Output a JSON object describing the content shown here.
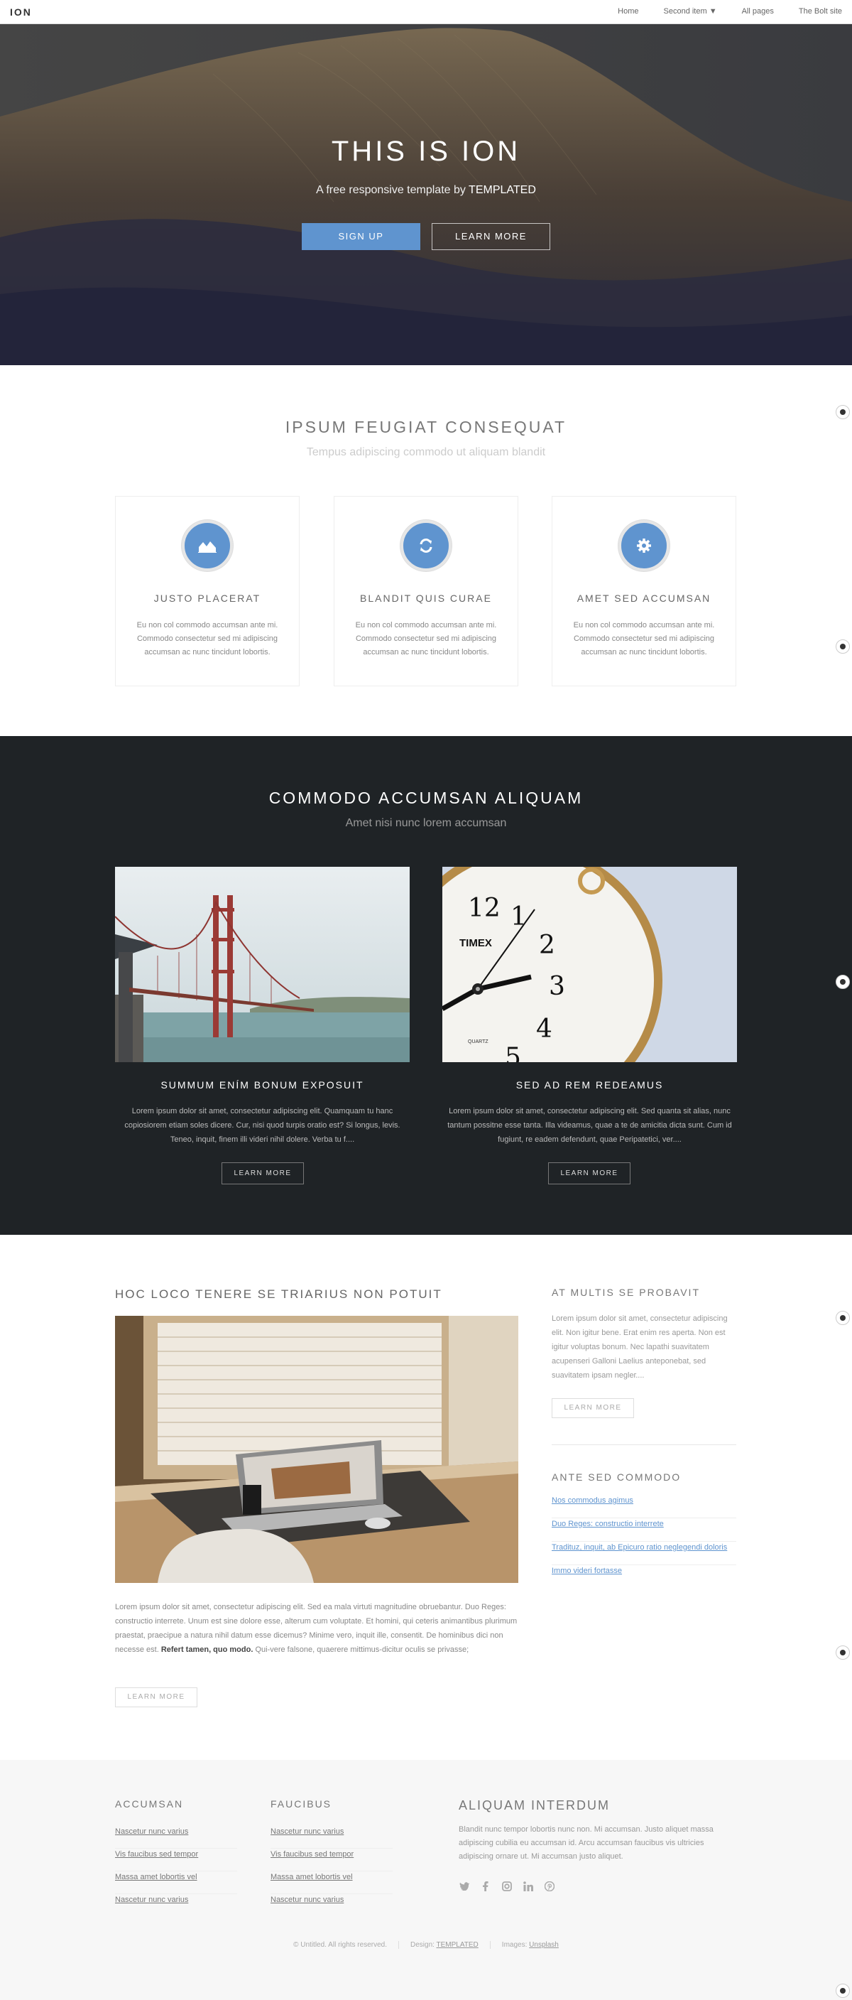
{
  "header": {
    "logo": "ION",
    "nav": [
      {
        "label": "Home"
      },
      {
        "label": "Second item ▼"
      },
      {
        "label": "All pages"
      },
      {
        "label": "The Bolt site"
      }
    ]
  },
  "hero": {
    "title": "THIS IS ION",
    "subtitle_prefix": "A free responsive template by ",
    "subtitle_brand": "TEMPLATED",
    "primary_button": "SIGN UP",
    "secondary_button": "LEARN MORE"
  },
  "features": {
    "title": "IPSUM FEUGIAT CONSEQUAT",
    "subtitle": "Tempus adipiscing commodo ut aliquam blandit",
    "items": [
      {
        "icon": "area-chart-icon",
        "title": "JUSTO PLACERAT",
        "text": "Eu non col commodo accumsan ante mi. Commodo consectetur sed mi adipiscing accumsan ac nunc tincidunt lobortis."
      },
      {
        "icon": "refresh-icon",
        "title": "BLANDIT QUIS CURAE",
        "text": "Eu non col commodo accumsan ante mi. Commodo consectetur sed mi adipiscing accumsan ac nunc tincidunt lobortis."
      },
      {
        "icon": "gear-icon",
        "title": "AMET SED ACCUMSAN",
        "text": "Eu non col commodo accumsan ante mi. Commodo consectetur sed mi adipiscing accumsan ac nunc tincidunt lobortis."
      }
    ]
  },
  "dark": {
    "title": "COMMODO ACCUMSAN ALIQUAM",
    "subtitle": "Amet nisi nunc lorem accumsan",
    "posts": [
      {
        "title": "SUMMUM ENÍM BONUM EXPOSUIT",
        "text": "Lorem ipsum dolor sit amet, consectetur adipiscing elit. Quamquam tu hanc copiosiorem etiam soles dicere. Cur, nisi quod turpis oratio est? Si longus, levis. Teneo, inquit, finem illi videri nihil dolere. Verba tu f....",
        "button": "LEARN MORE"
      },
      {
        "title": "SED AD REM REDEAMUS",
        "text": "Lorem ipsum dolor sit amet, consectetur adipiscing elit. Sed quanta sit alias, nunc tantum possitne esse tanta. Illa videamus, quae a te de amicitia dicta sunt. Cum id fugiunt, re eadem defendunt, quae Peripatetici, ver....",
        "button": "LEARN MORE"
      }
    ],
    "clock_brand": "TIMEX",
    "clock_sub": "QUARTZ"
  },
  "main": {
    "title": "HOC LOCO TENERE SE TRIARIUS NON POTUIT",
    "text_before_bold": "Lorem ipsum dolor sit amet, consectetur adipiscing elit. Sed ea mala virtuti magnitudine obruebantur. Duo Reges: constructio interrete. Unum est sine dolore esse, alterum cum voluptate. Et homini, qui ceteris animantibus plurimum praestat, praecipue a natura nihil datum esse dicemus? Minime vero, inquit ille, consentit. De hominibus dici non necesse est. ",
    "text_bold": "Refert tamen, quo modo.",
    "text_after_bold": " Qui-vere falsone, quaerere mittimus-dicitur oculis se privasse;",
    "button": "LEARN MORE"
  },
  "sidebar": {
    "box1_title": "AT MULTIS SE PROBAVIT",
    "box1_text": "Lorem ipsum dolor sit amet, consectetur adipiscing elit. Non igitur bene. Erat enim res aperta. Non est igitur voluptas bonum. Nec lapathi suavitatem acupenseri Galloni Laelius anteponebat, sed suavitatem ipsam neglег....",
    "box1_button": "LEARN MORE",
    "box2_title": "ANTE SED COMMODO",
    "links": [
      {
        "label": "Nos commodus agimus"
      },
      {
        "label": "Duo Reges: constructio interrete"
      },
      {
        "label": "Tradituz, inquit, ab Epicuro ratio neglegendi doloris"
      },
      {
        "label": "Immo videri fortasse"
      }
    ]
  },
  "footer": {
    "col1_title": "ACCUMSAN",
    "col1_links": [
      {
        "label": "Nascetur nunc varius"
      },
      {
        "label": "Vis faucibus sed tempor"
      },
      {
        "label": "Massa amet lobortis vel"
      },
      {
        "label": "Nascetur nunc varius"
      }
    ],
    "col2_title": "FAUCIBUS",
    "col2_links": [
      {
        "label": "Nascetur nunc varius"
      },
      {
        "label": "Vis faucibus sed tempor"
      },
      {
        "label": "Massa amet lobortis vel"
      },
      {
        "label": "Nascetur nunc varius"
      }
    ],
    "col3_title": "ALIQUAM INTERDUM",
    "col3_text": "Blandit nunc tempor lobortis nunc non. Mi accumsan. Justo aliquet massa adipiscing cubilia eu accumsan id. Arcu accumsan faucibus vis ultricies adipiscing ornare ut. Mi accumsan justo aliquet.",
    "socials": [
      "twitter-icon",
      "facebook-icon",
      "instagram-icon",
      "linkedin-icon",
      "pinterest-icon"
    ],
    "copyright": "© Untitled. All rights reserved.",
    "design_label": "Design: ",
    "design_link": "TEMPLATED",
    "images_label": "Images: ",
    "images_link": "Unsplash"
  },
  "colors": {
    "accent": "#5f94cf",
    "dark_bg": "#1f2326",
    "footer_bg": "#f7f7f7"
  }
}
